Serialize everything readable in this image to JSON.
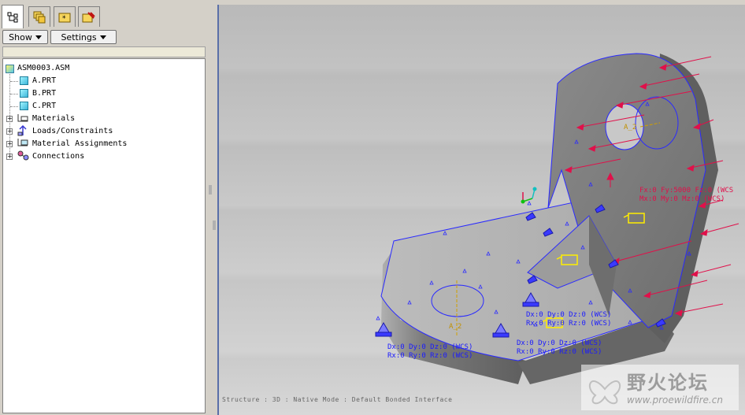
{
  "tabs": [
    {
      "icon": "model-tree-icon",
      "active": true
    },
    {
      "icon": "layers-icon",
      "active": false
    },
    {
      "icon": "favorites-folder-icon",
      "active": false
    },
    {
      "icon": "tools-folder-icon",
      "active": false
    }
  ],
  "buttons": {
    "show": "Show",
    "settings": "Settings"
  },
  "tree": {
    "root": "ASM0003.ASM",
    "parts": [
      "A.PRT",
      "B.PRT",
      "C.PRT"
    ],
    "groups": [
      "Materials",
      "Loads/Constraints",
      "Material Assignments",
      "Connections"
    ]
  },
  "viewport": {
    "load_line1": "Fx:0 Fy:5000 Fz:0 (WCS",
    "load_line2": "Mx:0 My:0 Mz:0 (WCS)",
    "c1_line1": "Dx:0 Dy:0 Dz:0 (WCS)",
    "c1_line2": "Rx:0 Ry:0 Rz:0 (WCS)",
    "c2_line1": "Dx:0 Dy:0 Dz:0 (WCS)",
    "c2_line2": "Rx:0 Ry:0 Rz:0 (WCS)",
    "c3_line1": "Dx:0 Dy:0 Dz:0 (WCS)",
    "c3_line2": "Rx:0 Ry:0 Rz:0 (WCS)",
    "axis_label_1": "A_2",
    "axis_label_2": "A_2",
    "status": "Structure : 3D : Native Mode : Default Bonded Interface"
  },
  "watermark": {
    "title": "野火论坛",
    "url": "www.proewildfire.cn"
  },
  "colors": {
    "arrow": "#e0104a",
    "edge": "#2a2aff",
    "fixture": "#3a3aff",
    "highlight": "#ffee00"
  }
}
